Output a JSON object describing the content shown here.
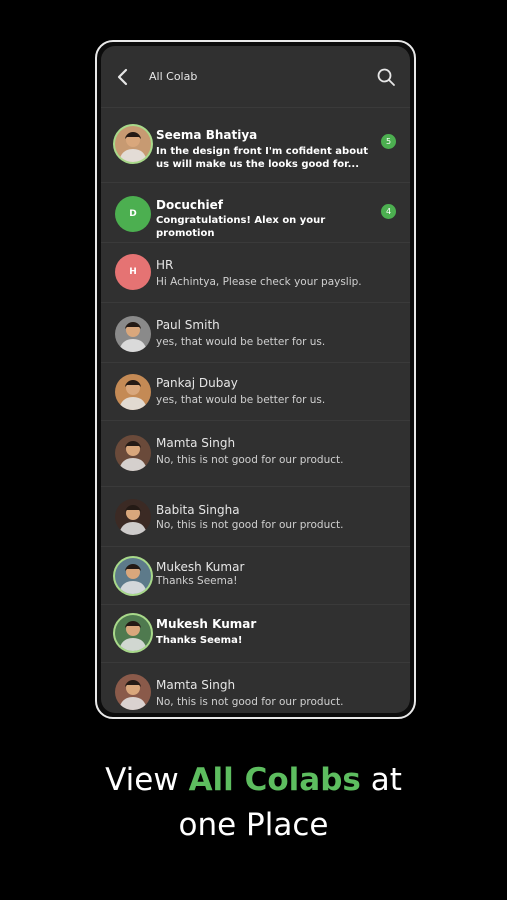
{
  "header": {
    "title": "All Colab"
  },
  "conversations": [
    {
      "name": "Seema Bhatiya",
      "message": "In the design front I'm cofident about us will make us the looks good for...",
      "badge": "5",
      "unread": true,
      "avatar": {
        "type": "photo",
        "ring": "#a8d98a",
        "bg": "#c79a72"
      }
    },
    {
      "name": "Docuchief",
      "message": "Congratulations! Alex on your promotion",
      "badge": "4",
      "unread": true,
      "avatar": {
        "type": "initial",
        "initial": "D",
        "bg": "#4caf50"
      }
    },
    {
      "name": "HR",
      "message": "Hi Achintya, Please check your payslip.",
      "badge": "",
      "unread": false,
      "avatar": {
        "type": "initial",
        "initial": "H",
        "bg": "#e57373"
      }
    },
    {
      "name": "Paul Smith",
      "message": "yes, that would be better for us.",
      "badge": "",
      "unread": false,
      "avatar": {
        "type": "photo",
        "ring": "",
        "bg": "#8a8a8a"
      }
    },
    {
      "name": "Pankaj Dubay",
      "message": "yes, that would be better for us.",
      "badge": "",
      "unread": false,
      "avatar": {
        "type": "photo",
        "ring": "",
        "bg": "#c48a55"
      }
    },
    {
      "name": "Mamta Singh",
      "message": "No, this is not good for our product.",
      "badge": "",
      "unread": false,
      "avatar": {
        "type": "photo",
        "ring": "",
        "bg": "#6a4a3a"
      }
    },
    {
      "name": "Babita Singha",
      "message": "No, this is not good for our product.",
      "badge": "",
      "unread": false,
      "avatar": {
        "type": "photo",
        "ring": "",
        "bg": "#3b2a24"
      }
    },
    {
      "name": "Mukesh Kumar",
      "message": "Thanks Seema!",
      "badge": "",
      "unread": false,
      "avatar": {
        "type": "photo",
        "ring": "#a8d98a",
        "bg": "#5d7a8a"
      }
    },
    {
      "name": "Mukesh Kumar",
      "message": "Thanks Seema!",
      "badge": "",
      "unread": true,
      "avatar": {
        "type": "photo",
        "ring": "#a8d98a",
        "bg": "#4f7a4f"
      }
    },
    {
      "name": "Mamta Singh",
      "message": "No, this is not good for our product.",
      "badge": "",
      "unread": false,
      "avatar": {
        "type": "photo",
        "ring": "",
        "bg": "#8a5a4a"
      }
    }
  ],
  "caption": {
    "line1_pre": "View ",
    "highlight": "All Colabs",
    "line1_post": " at",
    "line2": "one Place"
  },
  "colors": {
    "accent": "#5dbd5f",
    "screen_bg": "#303030",
    "badge": "#4caf50"
  },
  "icons": {
    "back": "chevron-left-icon",
    "search": "search-icon"
  }
}
